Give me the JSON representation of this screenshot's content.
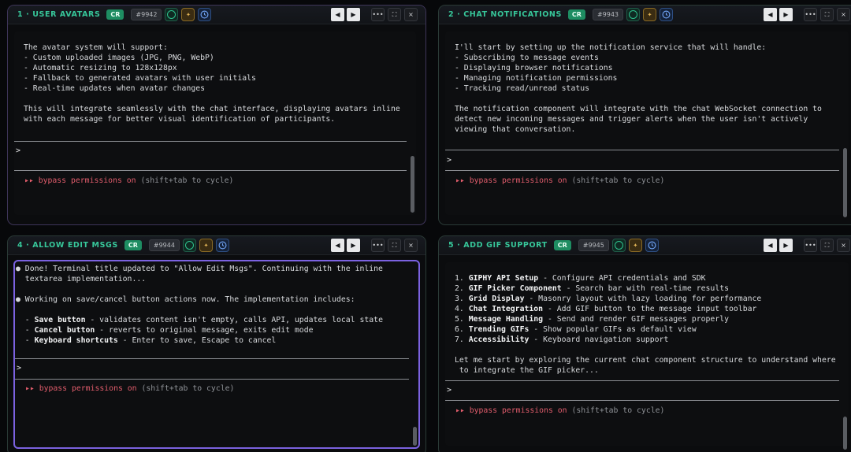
{
  "panes": [
    {
      "title": "1 · USER AVATARS",
      "cr": "CR",
      "id": "#9942",
      "lines": [
        "The avatar system will support:",
        "- Custom uploaded images (JPG, PNG, WebP)",
        "- Automatic resizing to 128x128px",
        "- Fallback to generated avatars with user initials",
        "- Real-time updates when avatar changes",
        "",
        "This will integrate seamlessly with the chat interface, displaying avatars inline",
        "with each message for better visual identification of participants."
      ],
      "prompt": ">",
      "status_on": "▸▸ bypass permissions on",
      "status_hint": " (shift+tab to cycle)"
    },
    {
      "title": "2 · CHAT NOTIFICATIONS",
      "cr": "CR",
      "id": "#9943",
      "lines": [
        "I'll start by setting up the notification service that will handle:",
        "- Subscribing to message events",
        "- Displaying browser notifications",
        "- Managing notification permissions",
        "- Tracking read/unread status",
        "",
        "The notification component will integrate with the chat WebSocket connection to",
        "detect new incoming messages and trigger alerts when the user isn't actively",
        "viewing that conversation."
      ],
      "prompt": ">",
      "status_on": "▸▸ bypass permissions on",
      "status_hint": " (shift+tab to cycle)"
    },
    {
      "title": "4 · ALLOW EDIT MSGS",
      "cr": "CR",
      "id": "#9944",
      "lines": [
        "● Done! Terminal title updated to \"Allow Edit Msgs\". Continuing with the inline",
        "  textarea implementation...",
        "",
        "● Working on save/cancel button actions now. The implementation includes:",
        "",
        "  - Save button - validates content isn't empty, calls API, updates local state",
        "  - Cancel button - reverts to original message, exits edit mode",
        "  - Keyboard shortcuts - Enter to save, Escape to cancel"
      ],
      "bold_prefix": [
        "",
        "",
        "",
        "",
        "",
        "Save button",
        "Cancel button",
        "Keyboard shortcuts"
      ],
      "prompt": ">",
      "status_on": "▸▸ bypass permissions on",
      "status_hint": " (shift+tab to cycle)"
    },
    {
      "title": "5 · ADD GIF SUPPORT",
      "cr": "CR",
      "id": "#9945",
      "lines": [
        "1. GIPHY API Setup - Configure API credentials and SDK",
        "2. GIF Picker Component - Search bar with real-time results",
        "3. Grid Display - Masonry layout with lazy loading for performance",
        "4. Chat Integration - Add GIF button to the message input toolbar",
        "5. Message Handling - Send and render GIF messages properly",
        "6. Trending GIFs - Show popular GIFs as default view",
        "7. Accessibility - Keyboard navigation support",
        "",
        "Let me start by exploring the current chat component structure to understand where",
        " to integrate the GIF picker..."
      ],
      "bold_prefix": [
        "GIPHY API Setup",
        "GIF Picker Component",
        "Grid Display",
        "Chat Integration",
        "Message Handling",
        "Trending GIFs",
        "Accessibility",
        "",
        "",
        ""
      ],
      "prompt": ">",
      "status_on": "▸▸ bypass permissions on",
      "status_hint": " (shift+tab to cycle)"
    }
  ],
  "controls": {
    "prev": "◀",
    "next": "▶",
    "more": "•••",
    "expand": "⛶",
    "close": "×",
    "spark": "✦"
  },
  "colors": {
    "accent_green": "#37c79a",
    "focus_border": "#7b62e0",
    "status_red": "#e25d6c"
  }
}
